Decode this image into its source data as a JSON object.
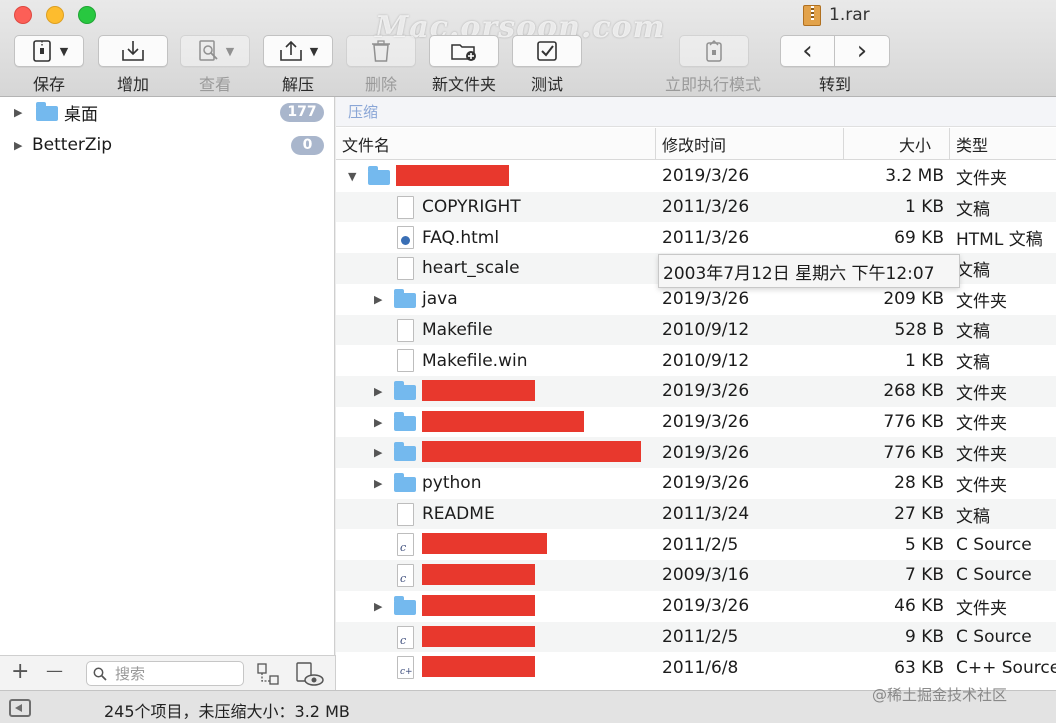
{
  "window": {
    "title": "1.rar",
    "watermark": "Mac.orsoon.com"
  },
  "toolbar": {
    "save": "保存",
    "add": "增加",
    "view": "查看",
    "extract": "解压",
    "delete": "删除",
    "new_folder": "新文件夹",
    "test": "测试",
    "immediate_mode": "立即执行模式",
    "goto": "转到",
    "back_glyph": "‹",
    "forward_glyph": "›"
  },
  "sidebar": {
    "items": [
      {
        "name": "桌面",
        "badge": "177",
        "icon": "folder-icon"
      },
      {
        "name": "BetterZip",
        "badge": "0"
      }
    ],
    "add_glyph": "+",
    "remove_glyph": "—",
    "search_placeholder": "搜索"
  },
  "main": {
    "path": "压缩",
    "columns": {
      "name": "文件名",
      "modified": "修改时间",
      "size": "大小",
      "kind": "类型"
    },
    "tooltip": "2003年7月12日 星期六 下午12:07",
    "rows": [
      {
        "name": "",
        "redacted": true,
        "date": "2019/3/26",
        "size": "3.2 MB",
        "kind": "文件夹",
        "icon": "folder",
        "disclosure": "open"
      },
      {
        "name": "COPYRIGHT",
        "date": "2011/3/26",
        "size": "1 KB",
        "kind": "文稿",
        "icon": "document"
      },
      {
        "name": "FAQ.html",
        "date": "2011/3/26",
        "size": "69 KB",
        "kind": "HTML 文稿",
        "icon": "html"
      },
      {
        "name": "heart_scale",
        "date": "",
        "size": "",
        "kind": "文稿",
        "icon": "document"
      },
      {
        "name": "java",
        "date": "2019/3/26",
        "size": "209 KB",
        "kind": "文件夹",
        "icon": "folder",
        "disclosure": "closed"
      },
      {
        "name": "Makefile",
        "date": "2010/9/12",
        "size": "528 B",
        "kind": "文稿",
        "icon": "document"
      },
      {
        "name": "Makefile.win",
        "date": "2010/9/12",
        "size": "1 KB",
        "kind": "文稿",
        "icon": "document"
      },
      {
        "name": "",
        "redacted": true,
        "date": "2019/3/26",
        "size": "268 KB",
        "kind": "文件夹",
        "icon": "folder",
        "disclosure": "closed"
      },
      {
        "name": "",
        "redacted": true,
        "date": "2019/3/26",
        "size": "776 KB",
        "kind": "文件夹",
        "icon": "folder",
        "disclosure": "closed"
      },
      {
        "name": "",
        "redacted": true,
        "date": "2019/3/26",
        "size": "776 KB",
        "kind": "文件夹",
        "icon": "folder",
        "disclosure": "closed"
      },
      {
        "name": "python",
        "date": "2019/3/26",
        "size": "28 KB",
        "kind": "文件夹",
        "icon": "folder",
        "disclosure": "closed"
      },
      {
        "name": "README",
        "date": "2011/3/24",
        "size": "27 KB",
        "kind": "文稿",
        "icon": "document"
      },
      {
        "name": "",
        "redacted": true,
        "date": "2011/2/5",
        "size": "5 KB",
        "kind": "C Source",
        "icon": "c-source"
      },
      {
        "name": "",
        "redacted": true,
        "date": "2009/3/16",
        "size": "7 KB",
        "kind": "C Source",
        "icon": "c-source"
      },
      {
        "name": "",
        "redacted": true,
        "date": "2019/3/26",
        "size": "46 KB",
        "kind": "文件夹",
        "icon": "folder",
        "disclosure": "closed"
      },
      {
        "name": "",
        "redacted": true,
        "date": "2011/2/5",
        "size": "9 KB",
        "kind": "C Source",
        "icon": "c-source"
      },
      {
        "name": "",
        "redacted": true,
        "date": "2011/6/8",
        "size": "63 KB",
        "kind": "C++ Source",
        "icon": "cpp-source"
      }
    ]
  },
  "status": {
    "text": "245个项目，未压缩大小：3.2 MB"
  },
  "credit": "@稀土掘金技术社区",
  "colors": {
    "accent": "#74b9ee",
    "redaction": "#e8382d",
    "badge": "#a9b6cc"
  }
}
